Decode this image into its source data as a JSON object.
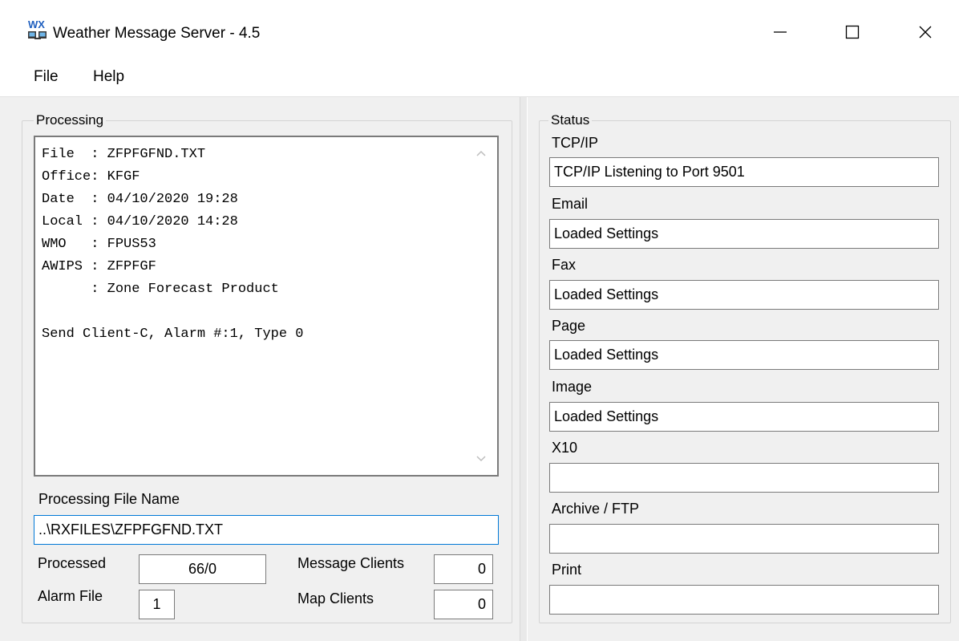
{
  "window": {
    "title": "Weather Message Server - 4.5",
    "icon_text": "WX",
    "controls": [
      "minimize-icon",
      "maximize-icon",
      "close-icon"
    ]
  },
  "menu": {
    "items": [
      "File",
      "Help"
    ]
  },
  "processing": {
    "legend": "Processing",
    "log_text": "File  : ZFPFGFND.TXT\nOffice: KFGF\nDate  : 04/10/2020 19:28\nLocal : 04/10/2020 14:28\nWMO   : FPUS53\nAWIPS : ZFPFGF\n      : Zone Forecast Product\n\nSend Client-C, Alarm #:1, Type 0",
    "file_name_label": "Processing File Name",
    "file_name_value": "..\\RXFILES\\ZFPFGFND.TXT",
    "processed_label": "Processed",
    "processed_value": "66/0",
    "alarm_file_label": "Alarm File",
    "alarm_file_value": "1",
    "message_clients_label": "Message Clients",
    "message_clients_value": "0",
    "map_clients_label": "Map Clients",
    "map_clients_value": "0"
  },
  "status": {
    "legend": "Status",
    "fields": [
      {
        "label": "TCP/IP",
        "value": "TCP/IP Listening to Port 9501"
      },
      {
        "label": "Email",
        "value": "Loaded Settings"
      },
      {
        "label": "Fax",
        "value": "Loaded Settings"
      },
      {
        "label": "Page",
        "value": "Loaded Settings"
      },
      {
        "label": "Image",
        "value": "Loaded Settings"
      },
      {
        "label": "X10",
        "value": ""
      },
      {
        "label": "Archive / FTP",
        "value": ""
      },
      {
        "label": "Print",
        "value": ""
      }
    ]
  }
}
